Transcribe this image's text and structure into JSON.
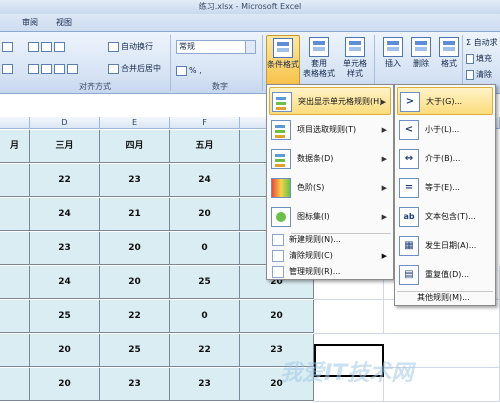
{
  "window": {
    "title": "练习.xlsx - Microsoft Excel"
  },
  "menu_tabs": [
    "审阅",
    "视图"
  ],
  "ribbon": {
    "wrap_text": "自动换行",
    "merge_center": "合并后居中",
    "number_format": "常规",
    "percent_comma": "% ,",
    "alignment_group": "对齐方式",
    "number_group": "数字",
    "conditional_format": "条件格式",
    "format_as_table": "套用\n表格格式",
    "cell_styles": "单元格\n样式",
    "insert": "插入",
    "delete": "删除",
    "format": "格式",
    "autosum": "Σ 自动求",
    "fill": "填充",
    "clear": "清除"
  },
  "sheet": {
    "col_headers": [
      "D",
      "E",
      "F"
    ],
    "month_headers": [
      "月",
      "三月",
      "四月",
      "五月"
    ],
    "rows": [
      [
        "",
        "22",
        "23",
        "24"
      ],
      [
        "",
        "24",
        "21",
        "20"
      ],
      [
        "",
        "23",
        "20",
        "0"
      ],
      [
        "",
        "24",
        "20",
        "25",
        "20"
      ],
      [
        "",
        "25",
        "22",
        "0",
        "20"
      ],
      [
        "",
        "20",
        "25",
        "22",
        "23"
      ],
      [
        "",
        "20",
        "23",
        "23",
        "20"
      ]
    ]
  },
  "conditional_menu": {
    "items": [
      {
        "label": "突出显示单元格规则(H)",
        "icon": "highlight-rules-icon"
      },
      {
        "label": "项目选取规则(T)",
        "icon": "top-bottom-icon"
      },
      {
        "label": "数据条(D)",
        "icon": "data-bars-icon"
      },
      {
        "label": "色阶(S)",
        "icon": "color-scale-icon"
      },
      {
        "label": "图标集(I)",
        "icon": "icon-sets-icon"
      }
    ],
    "small_items": [
      "新建规则(N)...",
      "清除规则(C)",
      "管理规则(R)..."
    ]
  },
  "highlight_submenu": {
    "items": [
      {
        "label": "大于(G)...",
        "glyph": ">"
      },
      {
        "label": "小于(L)...",
        "glyph": "<"
      },
      {
        "label": "介于(B)...",
        "glyph": "↔"
      },
      {
        "label": "等于(E)...",
        "glyph": "="
      },
      {
        "label": "文本包含(T)...",
        "glyph": "ab"
      },
      {
        "label": "发生日期(A)...",
        "glyph": "▦"
      },
      {
        "label": "重复值(D)...",
        "glyph": "▤"
      }
    ],
    "more": "其他规则(M)..."
  },
  "watermark": "我爱IT技术网"
}
